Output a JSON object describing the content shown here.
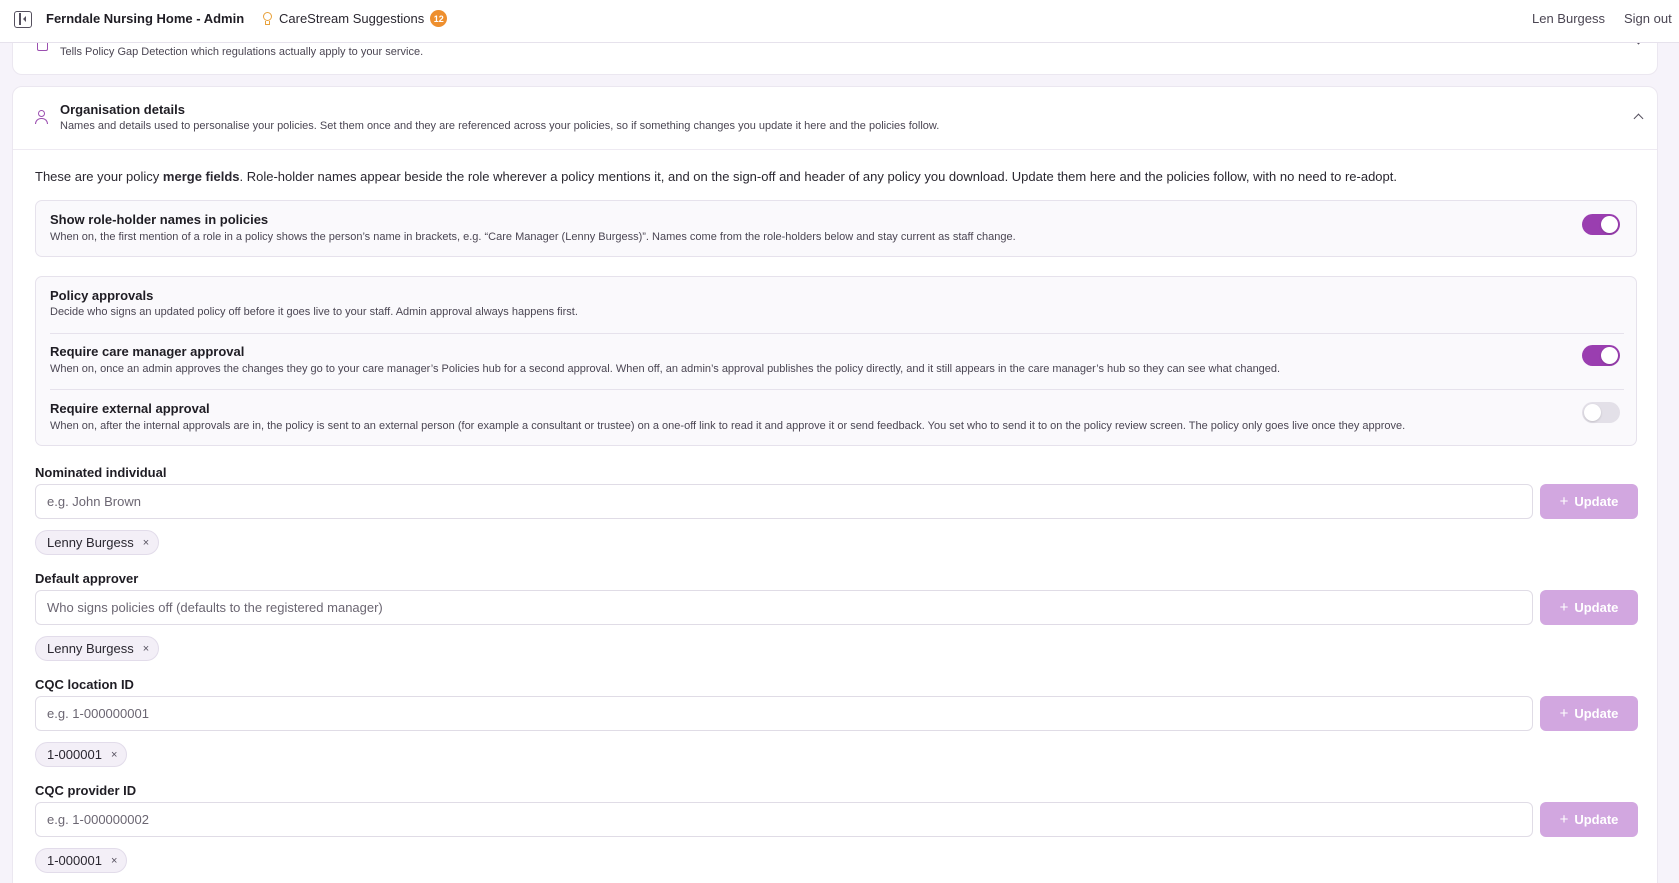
{
  "topbar": {
    "app_title": "Ferndale Nursing Home - Admin",
    "suggestions_label": "CareStream Suggestions",
    "suggestions_count": "12",
    "user_name": "Len Burgess",
    "sign_out": "Sign out"
  },
  "prev_section": {
    "description": "Tells Policy Gap Detection which regulations actually apply to your service."
  },
  "org_section": {
    "title": "Organisation details",
    "description": "Names and details used to personalise your policies. Set them once and they are referenced across your policies, so if something changes you update it here and the policies follow.",
    "intro_before": "These are your policy ",
    "intro_bold": "merge fields",
    "intro_after": ". Role-holder names appear beside the role wherever a policy mentions it, and on the sign-off and header of any policy you download. Update them here and the policies follow, with no need to re-adopt."
  },
  "settings": {
    "show_role_names": {
      "title": "Show role-holder names in policies",
      "description": "When on, the first mention of a role in a policy shows the person’s name in brackets, e.g. “Care Manager (Lenny Burgess)”. Names come from the role-holders below and stay current as staff change.",
      "enabled": true
    },
    "approvals": {
      "title": "Policy approvals",
      "description": "Decide who signs an updated policy off before it goes live to your staff. Admin approval always happens first.",
      "care_manager": {
        "title": "Require care manager approval",
        "description": "When on, once an admin approves the changes they go to your care manager’s Policies hub for a second approval. When off, an admin’s approval publishes the policy directly, and it still appears in the care manager’s hub so they can see what changed.",
        "enabled": true
      },
      "external": {
        "title": "Require external approval",
        "description": "When on, after the internal approvals are in, the policy is sent to an external person (for example a consultant or trustee) on a one-off link to read it and approve it or send feedback. You set who to send it to on the policy review screen. The policy only goes live once they approve.",
        "enabled": false
      }
    }
  },
  "fields": [
    {
      "label": "Nominated individual",
      "placeholder": "e.g. John Brown",
      "button": "Update",
      "chip": "Lenny Burgess"
    },
    {
      "label": "Default approver",
      "placeholder": "Who signs policies off (defaults to the registered manager)",
      "button": "Update",
      "chip": "Lenny Burgess"
    },
    {
      "label": "CQC location ID",
      "placeholder": "e.g. 1-000000001",
      "button": "Update",
      "chip": "1-000001"
    },
    {
      "label": "CQC provider ID",
      "placeholder": "e.g. 1-000000002",
      "button": "Update",
      "chip": "1-000001"
    }
  ],
  "chip_remove_glyph": "×",
  "plus_glyph": "+",
  "colors": {
    "accent": "#9a3eb0",
    "button_disabled": "#d2a7e0",
    "badge": "#ee8f2e"
  },
  "icons": [
    "sidebar-toggle-icon",
    "lightbulb-icon",
    "document-icon",
    "user-icon",
    "chevron-up-icon",
    "chevron-down-icon",
    "plus-icon",
    "close-icon"
  ]
}
